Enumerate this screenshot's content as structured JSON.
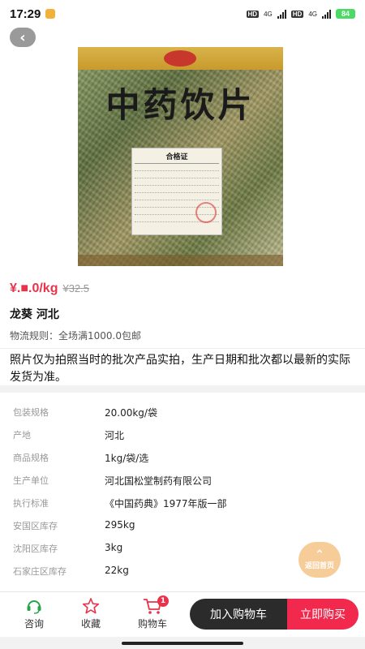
{
  "status_bar": {
    "time": "17:29",
    "battery": "84",
    "net1": "4G",
    "net2": "4G",
    "hd1": "HD",
    "hd2": "HD"
  },
  "product": {
    "photo_title": "中药饮片",
    "cert_title": "合格证",
    "price": "¥.■.0/kg",
    "original_price": "¥32.5",
    "name": "龙葵 河北",
    "shipping": "物流规则：全场满1000.0包邮"
  },
  "notice": "照片仅为拍照当时的批次产品实拍，生产日期和批次都以最新的实际发货为准。",
  "specs": [
    {
      "label": "包装规格",
      "value": "20.00kg/袋"
    },
    {
      "label": "产地",
      "value": "河北"
    },
    {
      "label": "商品规格",
      "value": "1kg/袋/选"
    },
    {
      "label": "生产单位",
      "value": "河北国松堂制药有限公司"
    },
    {
      "label": "执行标准",
      "value": "《中国药典》1977年版一部"
    },
    {
      "label": "安国区库存",
      "value": "295kg"
    },
    {
      "label": "沈阳区库存",
      "value": "3kg"
    },
    {
      "label": "石家庄区库存",
      "value": "22kg"
    }
  ],
  "float_home": {
    "label": "返回首页"
  },
  "bottom_nav": {
    "consult": "咨询",
    "favorite": "收藏",
    "cart": "购物车",
    "cart_count": "1",
    "add_to_cart": "加入购物车",
    "buy_now": "立即购买"
  },
  "colors": {
    "accent": "#f0294d",
    "price": "#e8334a",
    "dark_button": "#2b2b2b",
    "consult_icon": "#2ba34a"
  },
  "icons": {
    "back": "chevron-left-icon",
    "consult": "headset-icon",
    "favorite": "star-icon",
    "cart": "cart-icon"
  }
}
